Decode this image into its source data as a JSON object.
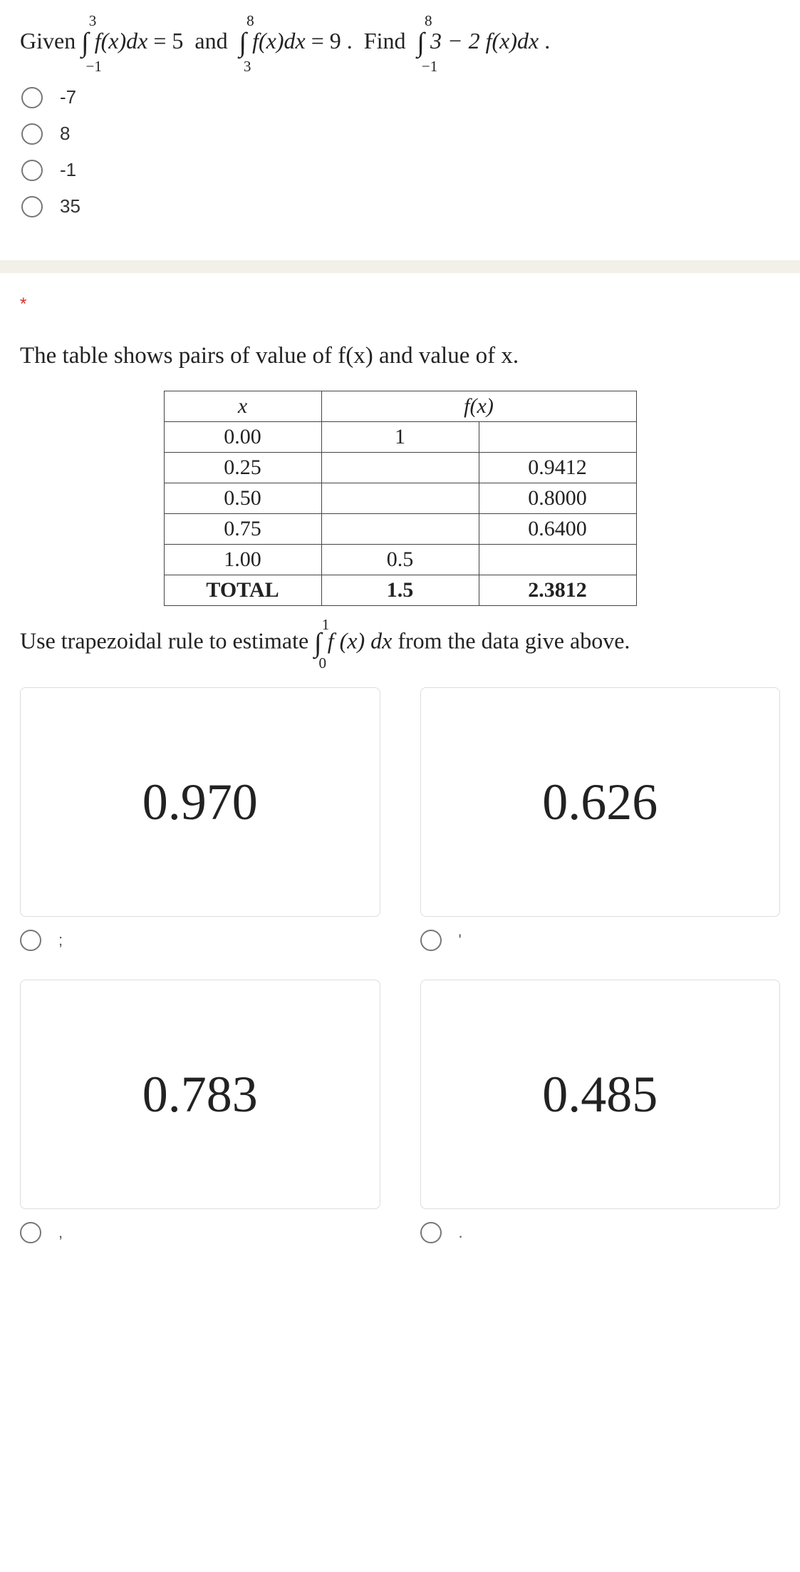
{
  "q1": {
    "given_word": "Given",
    "and_word": "and",
    "find_word": "Find",
    "int1": {
      "upper": "3",
      "lower": "−1",
      "body": "f(x)dx",
      "eq": "= 5"
    },
    "int2": {
      "upper": "8",
      "lower": "3",
      "body": "f(x)dx",
      "eq": "= 9"
    },
    "int3": {
      "upper": "8",
      "lower": "−1",
      "body": "3 − 2 f(x)dx"
    },
    "period": ".",
    "options": [
      "-7",
      "8",
      "-1",
      "35"
    ]
  },
  "q2": {
    "required": "*",
    "desc": "The table shows pairs of value of f(x) and value of x.",
    "headers": {
      "x": "x",
      "fx": "f(x)"
    },
    "rows": [
      {
        "x": "0.00",
        "a": "1",
        "b": ""
      },
      {
        "x": "0.25",
        "a": "",
        "b": "0.9412"
      },
      {
        "x": "0.50",
        "a": "",
        "b": "0.8000"
      },
      {
        "x": "0.75",
        "a": "",
        "b": "0.6400"
      },
      {
        "x": "1.00",
        "a": "0.5",
        "b": ""
      }
    ],
    "total_label": "TOTAL",
    "total_a": "1.5",
    "total_b": "2.3812",
    "instruction_pre": "Use trapezoidal rule to estimate ",
    "instruction_int": {
      "upper": "1",
      "lower": "0",
      "body": "f (x) dx"
    },
    "instruction_post": " from the data give above.",
    "answers": [
      "0.970",
      "0.626",
      "0.783",
      "0.485"
    ],
    "answer_marks": [
      ";",
      "'",
      ",",
      "."
    ]
  }
}
